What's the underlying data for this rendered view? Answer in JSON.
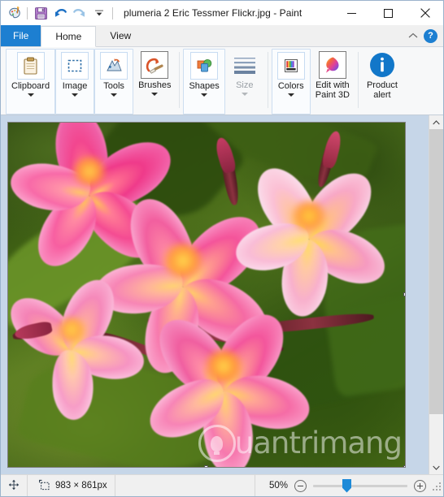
{
  "window": {
    "title": "plumeria 2 Eric Tessmer Flickr.jpg - Paint",
    "app_icon": "paint-palette-icon"
  },
  "quick_access": {
    "items": [
      {
        "name": "save-icon",
        "label": "Save"
      },
      {
        "name": "undo-icon",
        "label": "Undo"
      },
      {
        "name": "redo-icon",
        "label": "Redo"
      },
      {
        "name": "customize-quick-access-icon",
        "label": "Customize Quick Access Toolbar"
      }
    ]
  },
  "window_controls": {
    "minimize": "Minimize",
    "maximize": "Maximize",
    "close": "Close"
  },
  "tabs": {
    "items": [
      {
        "label": "File",
        "active": false,
        "style": "file"
      },
      {
        "label": "Home",
        "active": true,
        "style": "normal"
      },
      {
        "label": "View",
        "active": false,
        "style": "normal"
      }
    ],
    "collapse_label": "Minimize the Ribbon",
    "help_label": "?"
  },
  "ribbon": {
    "groups": [
      {
        "label": "Clipboard",
        "icon": "clipboard-icon",
        "has_caret": true,
        "disabled": false
      },
      {
        "label": "Image",
        "icon": "selection-icon",
        "has_caret": true,
        "disabled": false
      },
      {
        "label": "Tools",
        "icon": "tools-icon",
        "has_caret": true,
        "disabled": false
      },
      {
        "label": "Brushes",
        "icon": "brush-icon",
        "has_caret": true,
        "disabled": false
      },
      {
        "label": "Shapes",
        "icon": "shapes-icon",
        "has_caret": true,
        "disabled": false
      },
      {
        "label": "Size",
        "icon": "line-size-icon",
        "has_caret": true,
        "disabled": true
      },
      {
        "label": "Colors",
        "icon": "color-palette-icon",
        "has_caret": true,
        "disabled": false
      },
      {
        "label": "Edit with\nPaint 3D",
        "icon": "paint-3d-icon",
        "has_caret": false,
        "disabled": false
      },
      {
        "label": "Product\nalert",
        "icon": "info-icon",
        "has_caret": false,
        "disabled": false
      }
    ]
  },
  "canvas": {
    "image_name": "plumeria-photo",
    "alt": "Close-up of pink plumeria flowers with yellow centers on green foliage",
    "watermark_text": "uantrimang",
    "watermark_logo": "lightbulb-icon"
  },
  "status_bar": {
    "cursor_icon": "move-cursor-icon",
    "size_icon": "image-size-icon",
    "image_size": "983 × 861px",
    "zoom_level": "50%",
    "zoom_out_label": "Zoom out",
    "zoom_in_label": "Zoom in",
    "resize_grip": "resize-grip"
  },
  "colors": {
    "accent": "#1d7fd1",
    "ribbon_bg": "#f7f8f9",
    "canvas_bg": "#c6d6e8",
    "status_bg": "#f0f0f0"
  }
}
